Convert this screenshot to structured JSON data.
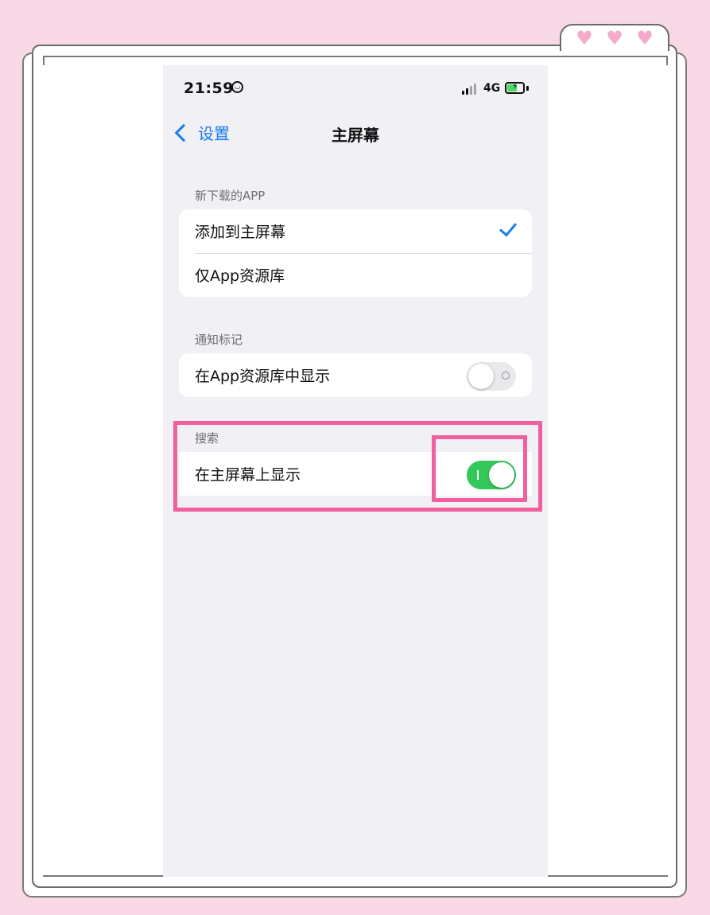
{
  "status_bar": {
    "time": "21:59",
    "network": "4G"
  },
  "nav": {
    "back_label": "设置",
    "title": "主屏幕"
  },
  "sections": {
    "new_apps": {
      "header": "新下载的APP",
      "options": [
        {
          "label": "添加到主屏幕",
          "selected": true
        },
        {
          "label": "仅App资源库",
          "selected": false
        }
      ]
    },
    "badges": {
      "header": "通知标记",
      "row": {
        "label": "在App资源库中显示",
        "toggle": "off"
      }
    },
    "search": {
      "header": "搜索",
      "row": {
        "label": "在主屏幕上显示",
        "toggle": "on"
      }
    }
  },
  "colors": {
    "accent": "#1a7cf2",
    "toggle_on": "#34c759",
    "highlight": "#f0609e",
    "background_pink": "#f9d9e6"
  }
}
